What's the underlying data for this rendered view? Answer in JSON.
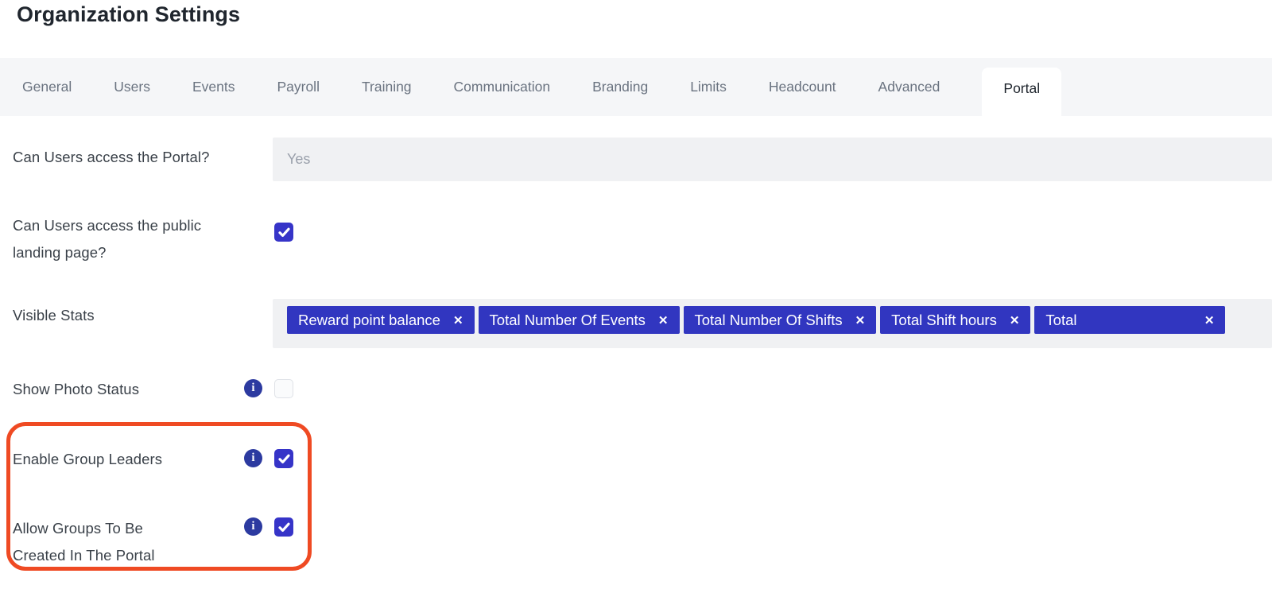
{
  "title": "Organization Settings",
  "tabs": {
    "active": "Portal",
    "items": [
      "General",
      "Users",
      "Events",
      "Payroll",
      "Training",
      "Communication",
      "Branding",
      "Limits",
      "Headcount",
      "Advanced",
      "Portal"
    ]
  },
  "form": {
    "portal_access": {
      "label": "Can Users access the Portal?",
      "value": "Yes",
      "disabled": true
    },
    "landing_page": {
      "label": "Can Users access the public\nlanding page?",
      "checked": true
    },
    "visible_stats": {
      "label": "Visible Stats",
      "tags": [
        {
          "label": "Reward point balance"
        },
        {
          "label": "Total Number Of Events"
        },
        {
          "label": "Total Number Of Shifts"
        },
        {
          "label": "Total Shift hours"
        },
        {
          "label": "Total",
          "clipped": true
        }
      ]
    },
    "show_photo_status": {
      "label": "Show Photo Status",
      "info": true,
      "checked": false
    },
    "enable_group_leaders": {
      "label": "Enable Group Leaders",
      "info": true,
      "checked": true
    },
    "allow_groups": {
      "label": "Allow Groups To Be\nCreated In The Portal",
      "info": true,
      "checked": true
    }
  },
  "icons": {
    "info": "i",
    "remove": "✕",
    "check": "✓"
  },
  "annotation": {
    "shape": "rounded-rect-highlight",
    "color": "#ef4a23"
  },
  "colors": {
    "tag_blue": "#3136c0",
    "checkbox_blue": "#3634c8",
    "info_blue": "#2c3aa0",
    "annotation_red": "#ef4a23",
    "tabbar_bg": "#f5f6f8",
    "field_bg": "#f0f1f3",
    "label_text": "#3a4149",
    "muted_text": "#9aa0ab",
    "tab_text": "#6a7380",
    "active_tab_text": "#1d232b",
    "title_text": "#20262e"
  }
}
